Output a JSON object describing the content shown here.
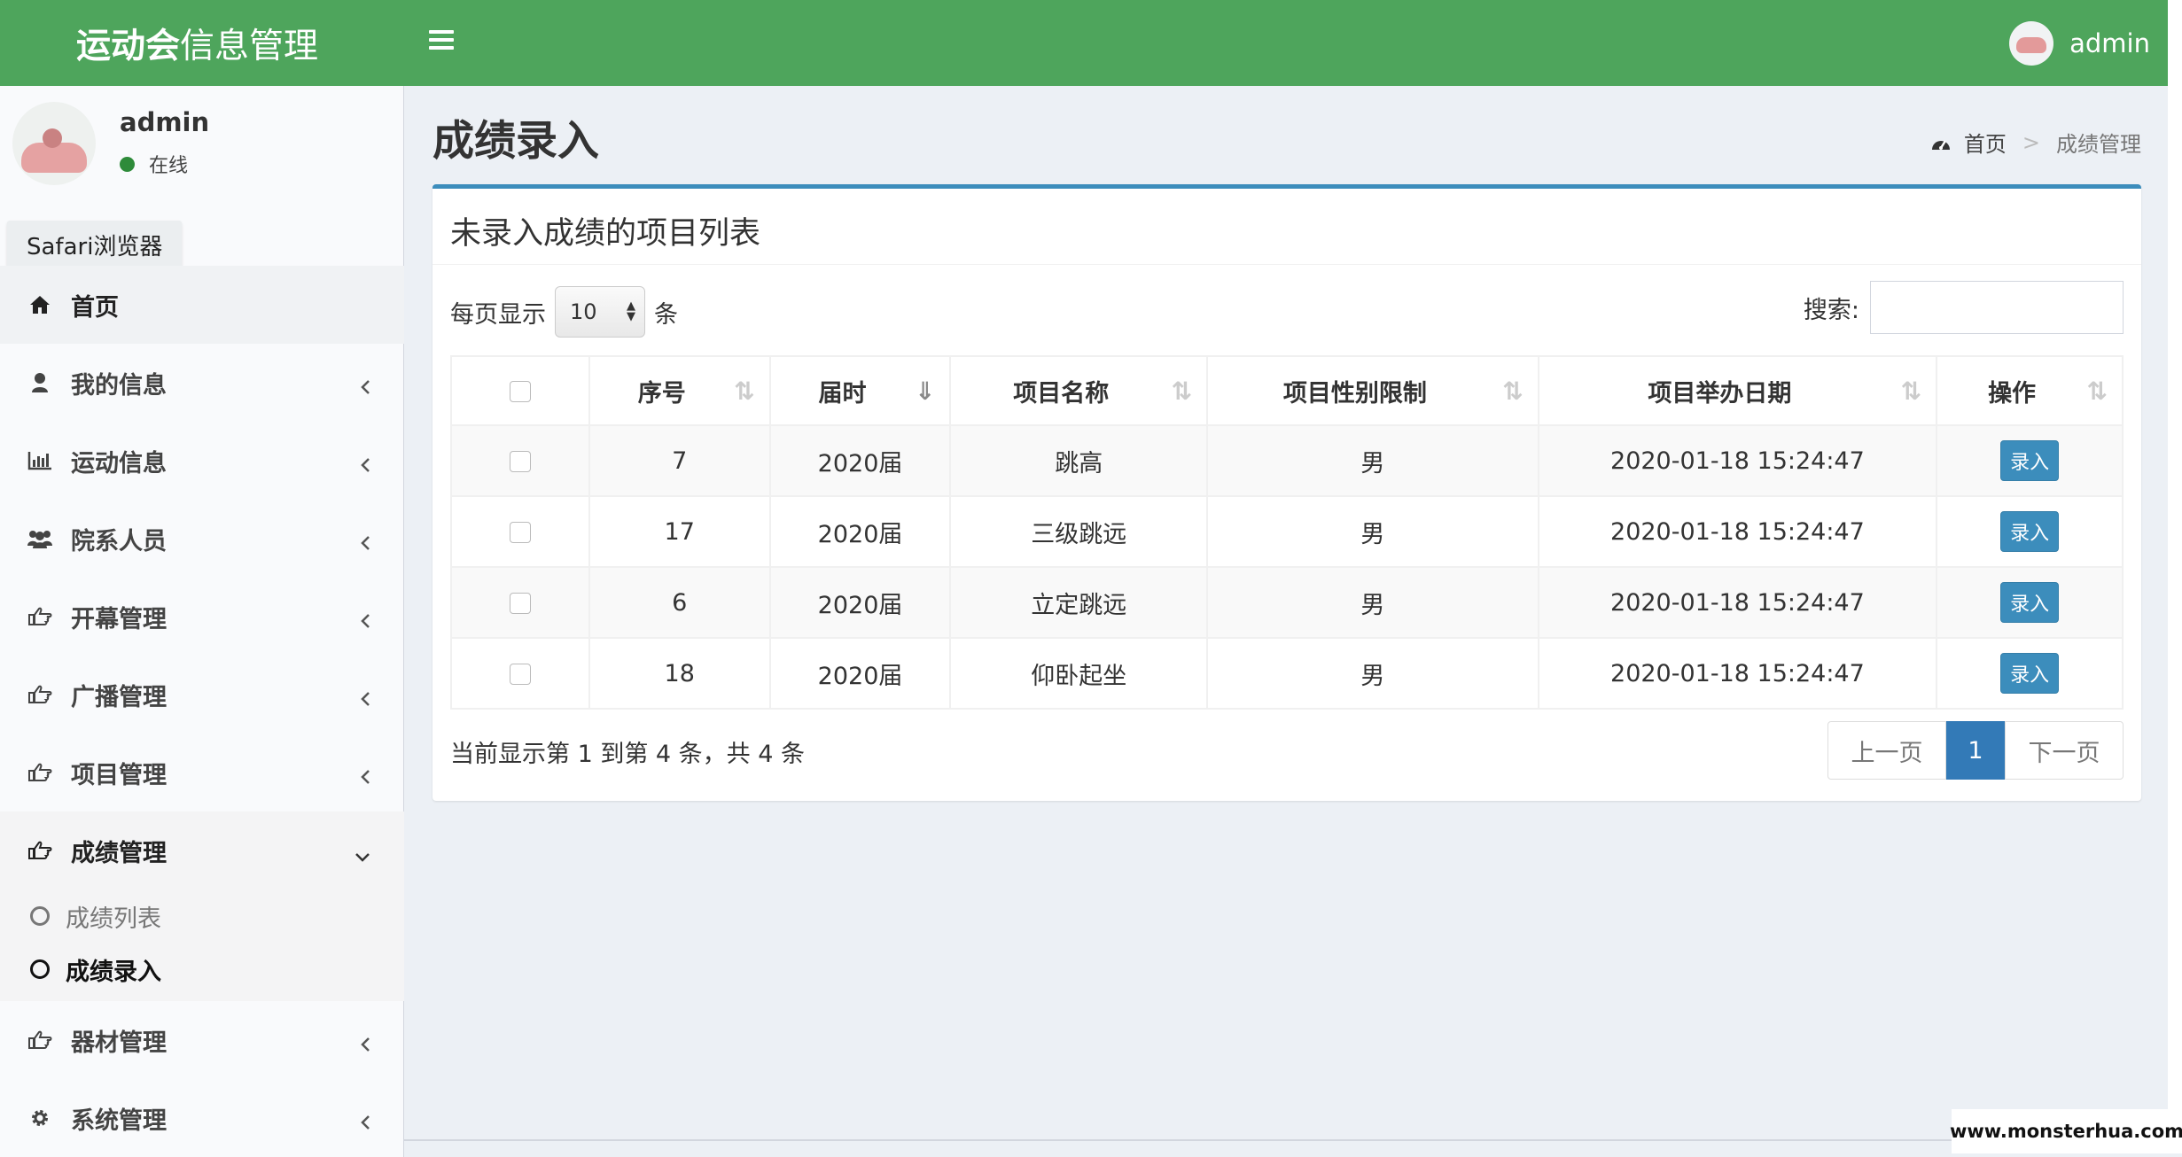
{
  "header": {
    "logo_bold": "运动会",
    "logo_light": "信息管理",
    "username": "admin"
  },
  "sidebar": {
    "username": "admin",
    "status": "在线",
    "tooltip": "Safari浏览器",
    "items": [
      {
        "label": "首页",
        "icon": "home-icon"
      },
      {
        "label": "我的信息",
        "icon": "user-icon"
      },
      {
        "label": "运动信息",
        "icon": "bar-chart-icon"
      },
      {
        "label": "院系人员",
        "icon": "users-icon"
      },
      {
        "label": "开幕管理",
        "icon": "hand-point-icon"
      },
      {
        "label": "广播管理",
        "icon": "hand-point-icon"
      },
      {
        "label": "项目管理",
        "icon": "hand-point-icon"
      },
      {
        "label": "成绩管理",
        "icon": "hand-point-icon"
      },
      {
        "label": "器材管理",
        "icon": "hand-point-icon"
      },
      {
        "label": "系统管理",
        "icon": "gear-icon"
      }
    ],
    "subitems": [
      {
        "label": "成绩列表"
      },
      {
        "label": "成绩录入"
      }
    ]
  },
  "page": {
    "title": "成绩录入",
    "breadcrumb_home": "首页",
    "breadcrumb_sep": ">",
    "breadcrumb_current": "成绩管理"
  },
  "box": {
    "title": "未录入成绩的项目列表",
    "length_prefix": "每页显示",
    "length_value": "10",
    "length_suffix": "条",
    "search_label": "搜索:",
    "search_value": ""
  },
  "table": {
    "columns": [
      "序号",
      "届时",
      "项目名称",
      "项目性别限制",
      "项目举办日期",
      "操作"
    ],
    "rows": [
      {
        "id": "7",
        "session": "2020届",
        "name": "跳高",
        "gender": "男",
        "date": "2020-01-18 15:24:47",
        "action": "录入"
      },
      {
        "id": "17",
        "session": "2020届",
        "name": "三级跳远",
        "gender": "男",
        "date": "2020-01-18 15:24:47",
        "action": "录入"
      },
      {
        "id": "6",
        "session": "2020届",
        "name": "立定跳远",
        "gender": "男",
        "date": "2020-01-18 15:24:47",
        "action": "录入"
      },
      {
        "id": "18",
        "session": "2020届",
        "name": "仰卧起坐",
        "gender": "男",
        "date": "2020-01-18 15:24:47",
        "action": "录入"
      }
    ]
  },
  "footer": {
    "info": "当前显示第 1 到第 4 条，共 4 条",
    "prev": "上一页",
    "page": "1",
    "next": "下一页"
  },
  "watermark": "www.monsterhua.com",
  "colors": {
    "header": "#4ea55c",
    "accent": "#3c8dbc",
    "pager_active": "#337ab7"
  }
}
